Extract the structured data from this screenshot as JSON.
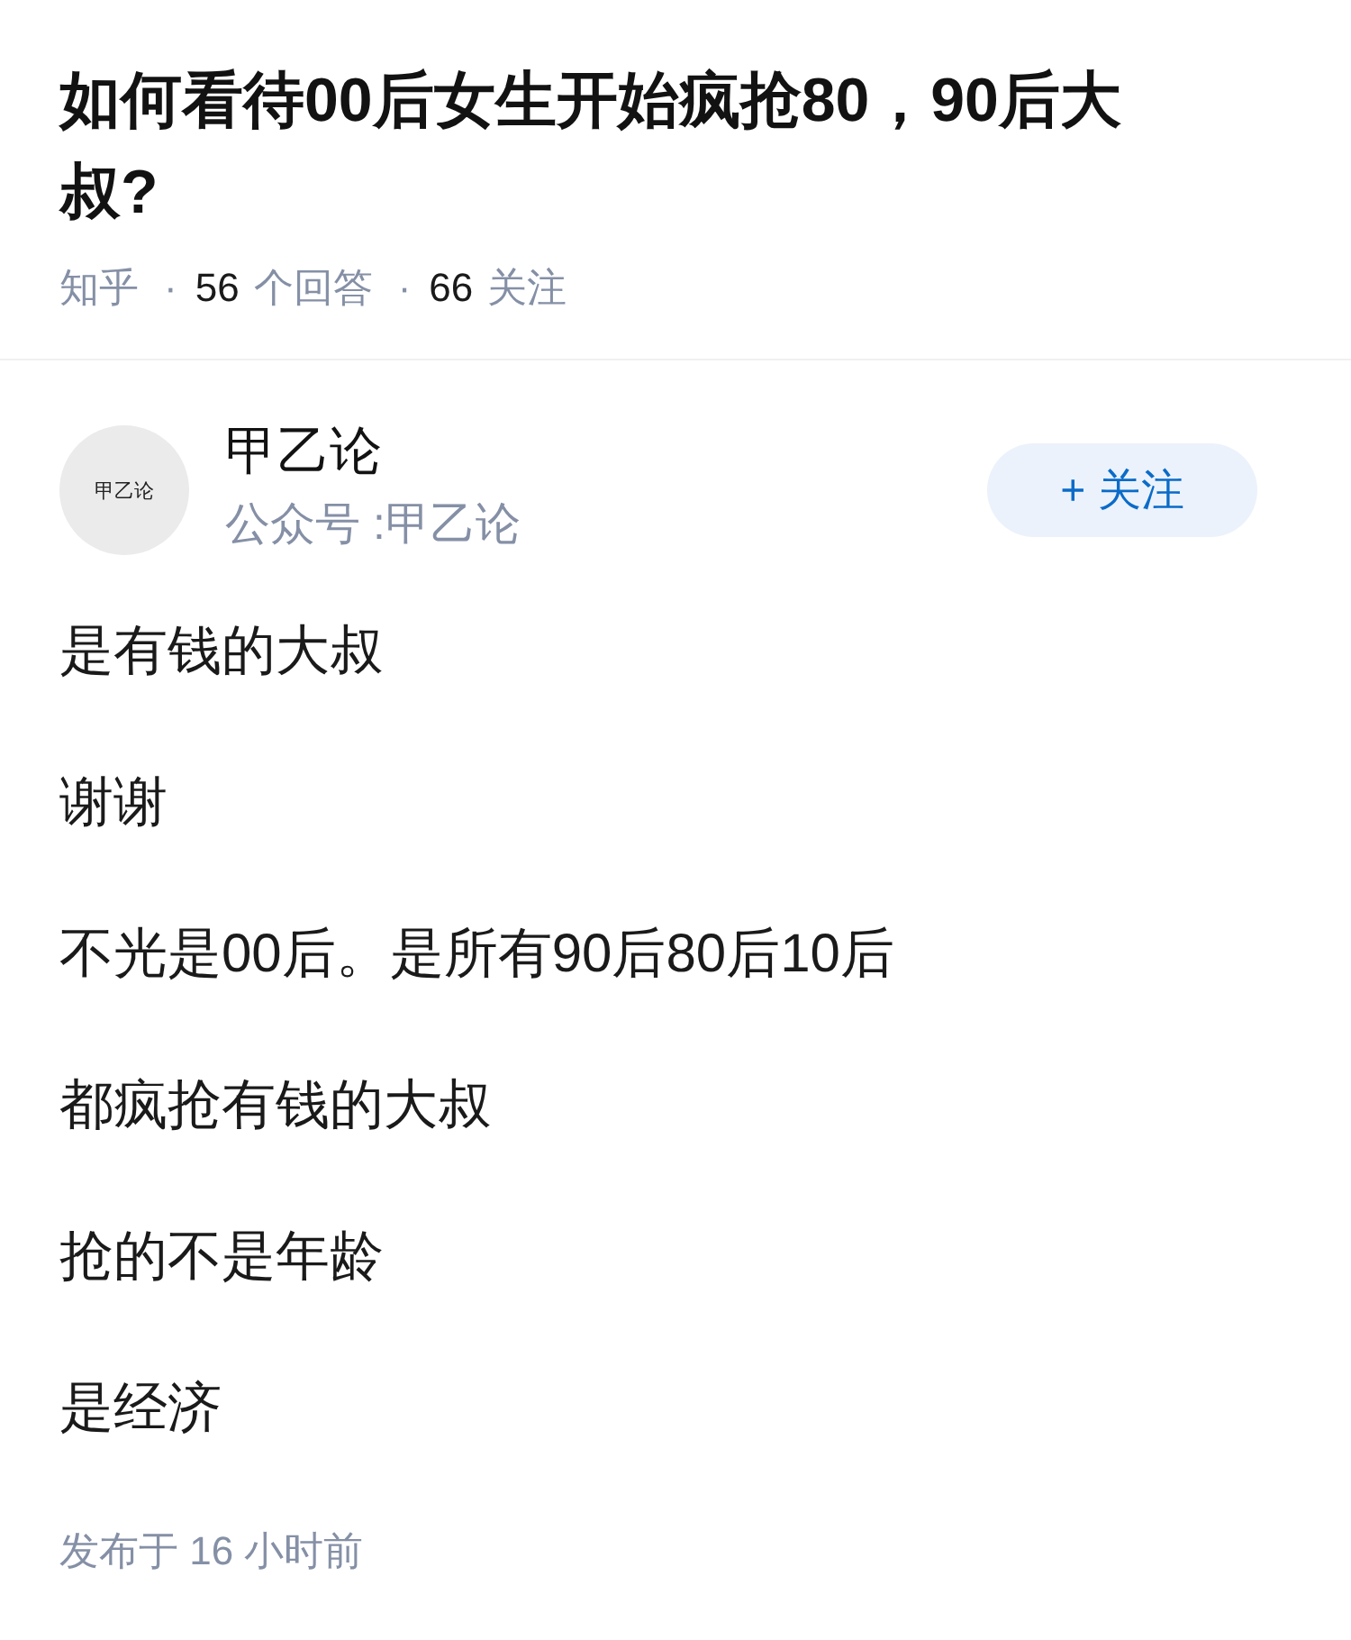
{
  "question": {
    "title": "如何看待00后女生开始疯抢80，90后大叔?",
    "meta": [
      {
        "kind": "source",
        "text": "知乎"
      },
      {
        "kind": "dot",
        "text": "·"
      },
      {
        "kind": "count",
        "text": "56"
      },
      {
        "kind": "label",
        "text": "个回答"
      },
      {
        "kind": "dot",
        "text": "·"
      },
      {
        "kind": "count",
        "text": "66"
      },
      {
        "kind": "label",
        "text": "关注"
      }
    ]
  },
  "author": {
    "avatar_text": "甲乙论",
    "name": "甲乙论",
    "subtitle": "公众号 :甲乙论",
    "follow_button": "+ 关注"
  },
  "answer": {
    "paragraphs": [
      "是有钱的大叔",
      "谢谢",
      "不光是00后。是所有90后80后10后",
      "都疯抢有钱的大叔",
      "抢的不是年龄",
      "是经济"
    ],
    "published": "发布于 16 小时前"
  }
}
